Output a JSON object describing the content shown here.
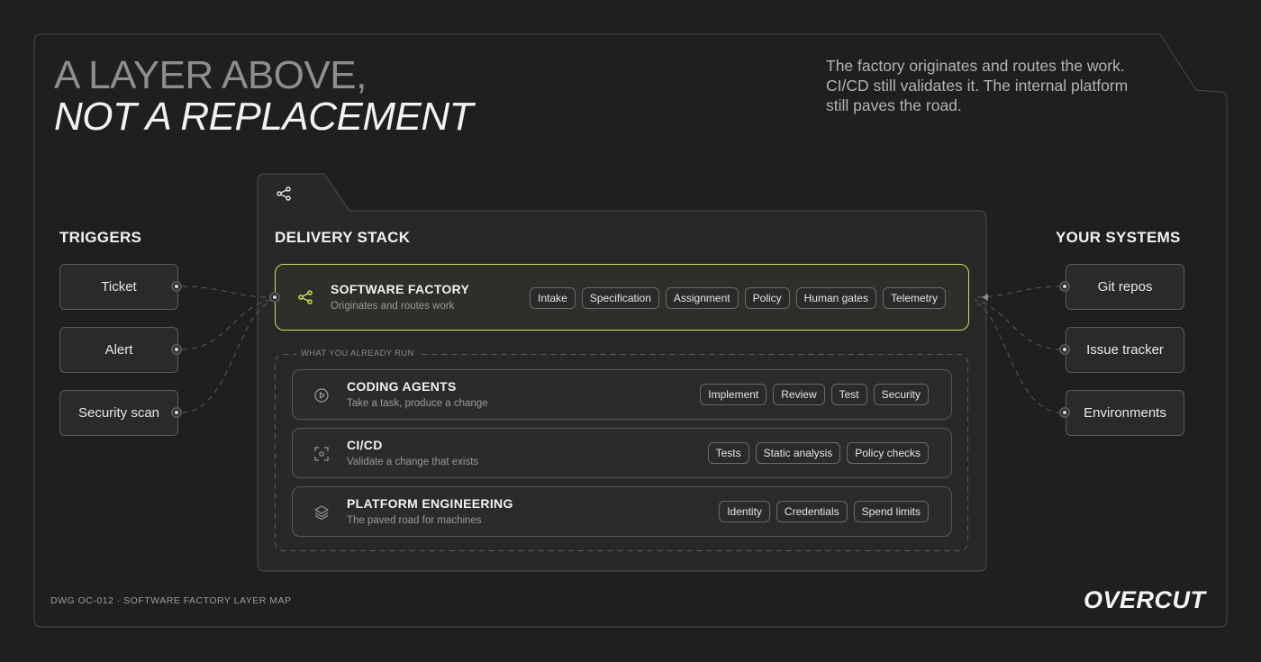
{
  "header": {
    "title_line1": "A LAYER ABOVE,",
    "title_line2": "NOT A REPLACEMENT",
    "intro": "The factory originates and routes the work. CI/CD still validates it. The internal platform still paves the road."
  },
  "triggers": {
    "heading": "TRIGGERS",
    "items": [
      "Ticket",
      "Alert",
      "Security scan"
    ]
  },
  "systems": {
    "heading": "YOUR SYSTEMS",
    "items": [
      "Git repos",
      "Issue tracker",
      "Environments"
    ]
  },
  "stack": {
    "heading": "DELIVERY STACK",
    "factory": {
      "name": "SOFTWARE FACTORY",
      "desc": "Originates and routes work",
      "chips": [
        "Intake",
        "Specification",
        "Assignment",
        "Policy",
        "Human gates",
        "Telemetry"
      ]
    },
    "group_label": "WHAT YOU ALREADY RUN",
    "layers": [
      {
        "name": "CODING AGENTS",
        "desc": "Take a task, produce a change",
        "icon": "play-circle-icon",
        "chips": [
          "Implement",
          "Review",
          "Test",
          "Security"
        ]
      },
      {
        "name": "CI/CD",
        "desc": "Validate a change that exists",
        "icon": "scan-frame-icon",
        "chips": [
          "Tests",
          "Static analysis",
          "Policy checks"
        ]
      },
      {
        "name": "PLATFORM ENGINEERING",
        "desc": "The paved road for machines",
        "icon": "layers-icon",
        "chips": [
          "Identity",
          "Credentials",
          "Spend limits"
        ]
      }
    ]
  },
  "footer": {
    "code": "DWG OC-012  ·  SOFTWARE FACTORY LAYER MAP",
    "brand": "OVERCUT"
  },
  "colors": {
    "background": "#1f1f1f",
    "accent": "#c9e15a",
    "border": "#5a5a5a"
  }
}
